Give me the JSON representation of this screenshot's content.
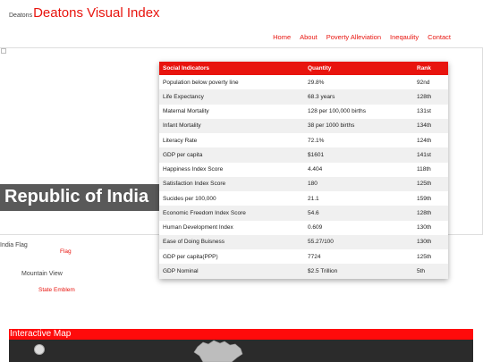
{
  "header": {
    "logo_alt": "Deatons",
    "logo_text": "Deatons Visual Index"
  },
  "nav": {
    "items": [
      "Home",
      "About",
      "Poverty Alleviation",
      "Ineqaulity",
      "Contact"
    ]
  },
  "hero": {
    "title": "Republic of India"
  },
  "indicators": {
    "headers": [
      "Social Indicators",
      "Quantity",
      "Rank"
    ],
    "rows": [
      [
        "Population below poverty line",
        "29.8%",
        "92nd"
      ],
      [
        "Life Expectancy",
        "68.3 years",
        "128th"
      ],
      [
        "Maternal Mortality",
        "128 per 100,000 births",
        "131st"
      ],
      [
        "Infant Mortality",
        "38 per 1000 births",
        "134th"
      ],
      [
        "Literacy Rate",
        "72.1%",
        "124th"
      ],
      [
        "GDP per capita",
        "$1601",
        "141st"
      ],
      [
        "Happiness Index Score",
        "4.404",
        "118th"
      ],
      [
        "Satisfaction Index Score",
        "180",
        "125th"
      ],
      [
        "Sucides per 100,000",
        "21.1",
        "159th"
      ],
      [
        "Economic Freedom Index Score",
        "54.6",
        "128th"
      ],
      [
        "Human Development Index",
        "0.609",
        "130th"
      ],
      [
        "Ease of Doing Buisness",
        "55.27/100",
        "130th"
      ],
      [
        "GDP per capita(PPP)",
        "7724",
        "125th"
      ],
      [
        "GDP Nominal",
        "$2.5 Trillion",
        "5th"
      ]
    ]
  },
  "flag": {
    "alt": "India Flag",
    "caption": "Flag"
  },
  "emblem": {
    "alt": "Mountain View",
    "caption": "State Emblem"
  },
  "map": {
    "title": "Interactive Map"
  }
}
